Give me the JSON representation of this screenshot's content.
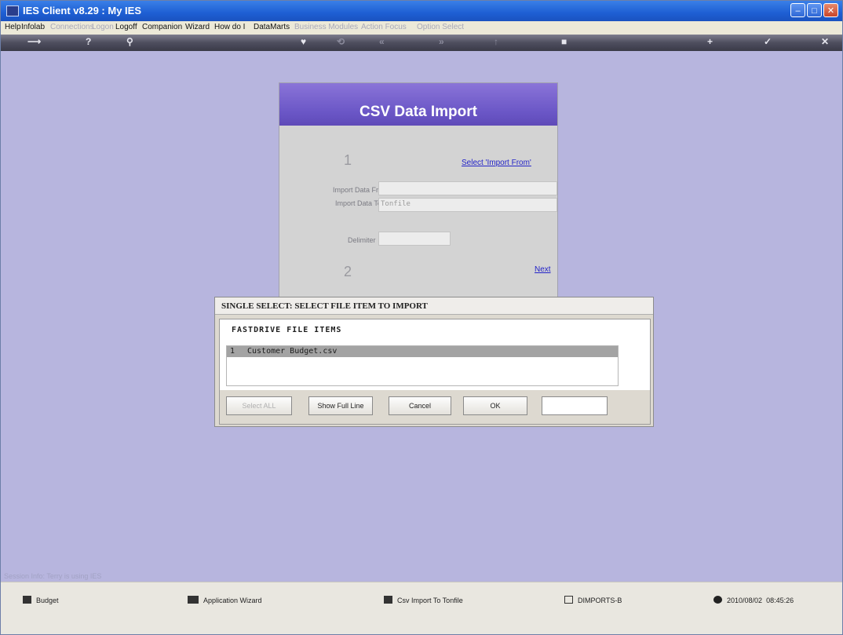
{
  "window": {
    "title": "IES Client v8.29 : My IES",
    "controls": {
      "minimize": "–",
      "maximize": "□",
      "close": "✕"
    }
  },
  "menu": {
    "items": [
      {
        "label": "Help",
        "enabled": true
      },
      {
        "label": "Infolab",
        "enabled": true
      },
      {
        "label": "Connections",
        "enabled": false
      },
      {
        "label": "Logon",
        "enabled": false
      },
      {
        "label": "Logoff",
        "enabled": true
      },
      {
        "label": "Companion",
        "enabled": true
      },
      {
        "label": "Wizard",
        "enabled": true
      },
      {
        "label": "How do I",
        "enabled": true
      },
      {
        "label": "DataMarts",
        "enabled": true
      },
      {
        "label": "Business Modules",
        "enabled": false
      },
      {
        "label": "Action Focus",
        "enabled": false
      },
      {
        "label": "Option Select",
        "enabled": false
      }
    ]
  },
  "toolbar": {
    "icons": [
      "back-arrow-icon",
      "help-icon",
      "search-icon",
      "heart-icon",
      "fast-back-icon",
      "previous-icon",
      "next-icon",
      "up-icon",
      "stop-icon",
      "add-icon",
      "check-icon",
      "close-icon"
    ]
  },
  "panel": {
    "title": "CSV Data Import",
    "step1": "1",
    "select_link": "Select 'Import From'",
    "import_from_label": "Import Data From",
    "import_from_value": "",
    "import_to_label": "Import Data To",
    "import_to_value": "Tonfile",
    "delimiter_label": "Delimiter",
    "delimiter_value": "",
    "step2": "2",
    "next_link": "Next"
  },
  "dialog": {
    "title": "SINGLE SELECT: SELECT FILE ITEM TO IMPORT",
    "list_heading": "FASTDRIVE FILE ITEMS",
    "items": [
      {
        "num": "1",
        "name": "Customer Budget.csv"
      }
    ],
    "buttons": {
      "select_all": "Select ALL",
      "show_full_line": "Show Full Line",
      "cancel": "Cancel",
      "ok": "OK"
    },
    "search_value": ""
  },
  "session_info": "Session Info: Terry is using IES",
  "status": {
    "budget": "Budget",
    "wizard": "Application Wizard",
    "csv_import": "Csv Import To Tonfile",
    "imports": "DIMPORTS-B",
    "date": "2010/08/02",
    "time": "08:45:26"
  }
}
